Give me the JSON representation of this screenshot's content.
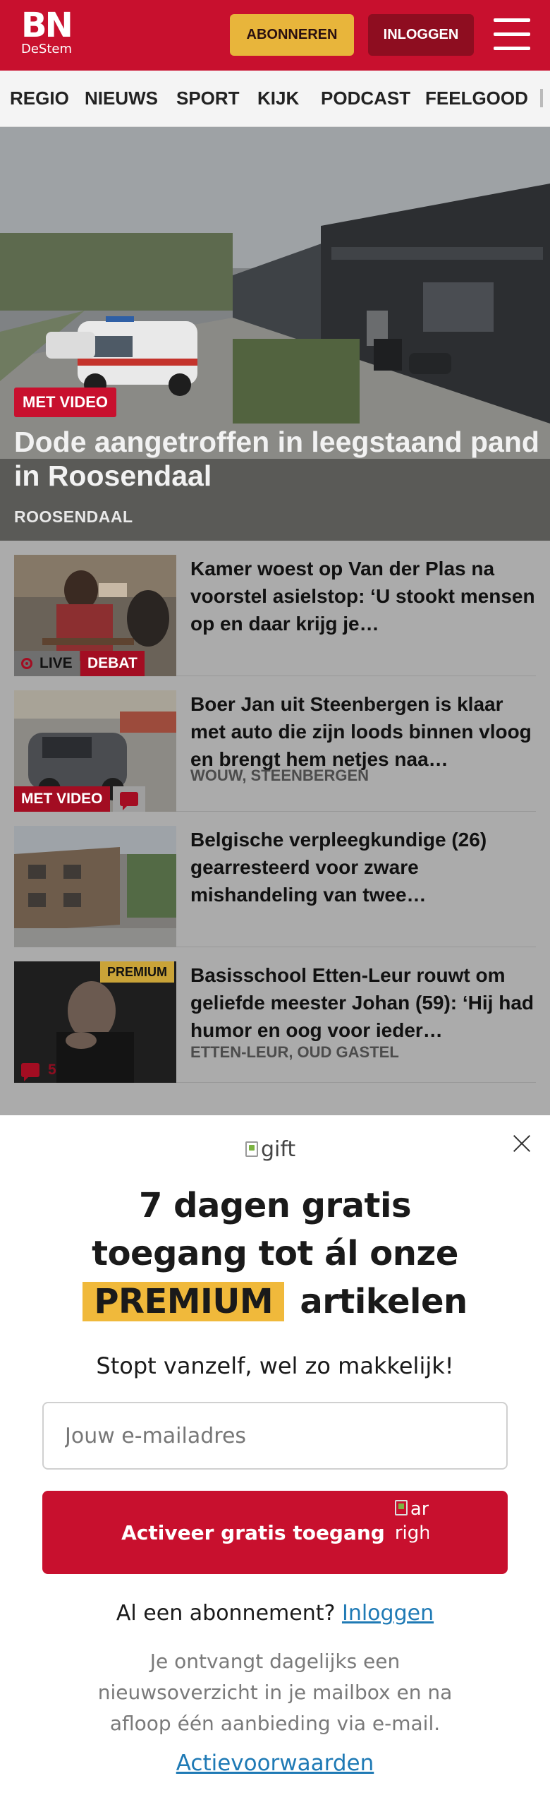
{
  "header": {
    "logo_main": "BN",
    "logo_sub": "DeStem",
    "subscribe_label": "ABONNEREN",
    "login_label": "INLOGGEN"
  },
  "nav": {
    "items": [
      "REGIO",
      "NIEUWS",
      "SPORT",
      "KIJK",
      "PODCAST",
      "FEELGOOD"
    ]
  },
  "hero": {
    "badge": "MET VIDEO",
    "title": "Dode aangetroffen in leegstaand pand in Roosendaal",
    "location": "ROOSENDAAL"
  },
  "articles": [
    {
      "title": "Kamer woest op Van der Plas na voorstel asielstop: ‘U stookt mensen op en daar krijg je…",
      "location": "",
      "tags": [
        "LIVE",
        "DEBAT"
      ]
    },
    {
      "title": "Boer Jan uit Steenbergen is klaar met auto die zijn loods binnen vloog en brengt hem netjes naa…",
      "location": "WOUW, STEENBERGEN",
      "tags": [
        "MET VIDEO"
      ]
    },
    {
      "title": "Belgische verpleegkundige (26) gearresteerd voor zware mishandeling van twee…",
      "location": "",
      "tags": []
    },
    {
      "title": "Basisschool Etten-Leur rouwt om geliefde meester Johan (59): ‘Hij had humor en oog voor ieder…",
      "location": "ETTEN-LEUR, OUD GASTEL",
      "tags": [
        "PREMIUM"
      ],
      "comments": "5"
    }
  ],
  "modal": {
    "gift_alt": "gift",
    "title_line1": "7 dagen gratis",
    "title_line2": "toegang tot ál onze",
    "title_highlight": "PREMIUM",
    "title_rest": "artikelen",
    "subtitle": "Stopt vanzelf, wel zo makkelijk!",
    "email_placeholder": "Jouw e-mailadres",
    "button_label": "Activeer gratis toegang",
    "button_icon_alt": "arrow right",
    "have_account_text": "Al een abonnement?",
    "login_link": "Inloggen",
    "info_text": "Je ontvangt dagelijks een nieuwsoverzicht in je mailbox en na afloop één aanbieding via e-mail.",
    "terms_link": "Actievoorwaarden"
  },
  "colors": {
    "brand_red": "#c8102e",
    "accent_yellow": "#e8b53b",
    "link_blue": "#1f7ab5"
  }
}
